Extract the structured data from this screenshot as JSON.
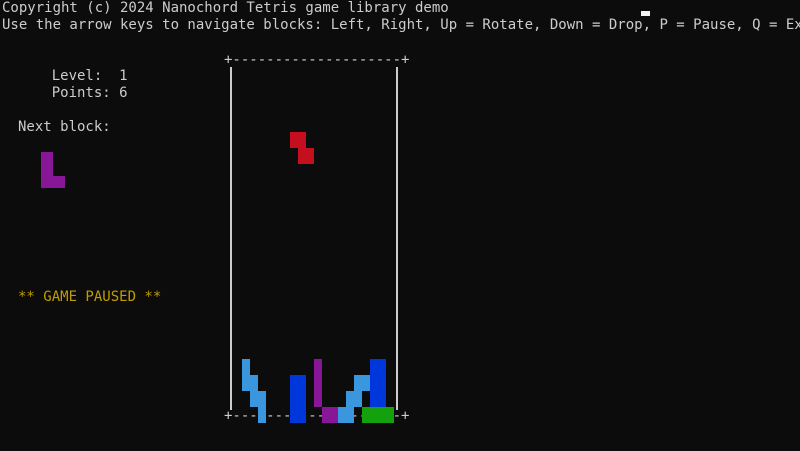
{
  "header": {
    "copyright": "Copyright (c) 2024 Nanochord Tetris game library demo",
    "instructions": "Use the arrow keys to navigate blocks: Left, Right, Up = Rotate, Down = Drop, P = Pause, Q = Exit"
  },
  "stats": {
    "level_label": "Level:",
    "level_value": "1",
    "points_label": "Points:",
    "points_value": "6",
    "next_block_label": "Next block:"
  },
  "status": {
    "paused_text": "** GAME PAUSED **"
  },
  "board": {
    "top_border": "+--------------------+",
    "bottom_border": "+--------------------+",
    "columns": 20,
    "rows": 43
  },
  "colors": {
    "background": "#0c0c0c",
    "text": "#cccccc",
    "paused": "#c19c00",
    "red": "#c50f1f",
    "purple": "#881798",
    "light_blue": "#3a96dd",
    "blue": "#0037da",
    "green": "#13a10e"
  },
  "next_block": {
    "shape": "L-tetromino",
    "color": "purple",
    "cells": [
      [
        0,
        0
      ],
      [
        0,
        1
      ],
      [
        0,
        2
      ],
      [
        1,
        2
      ]
    ]
  },
  "falling_block": {
    "shape": "Z-tetromino",
    "color": "red",
    "cells": [
      [
        7,
        19
      ],
      [
        8,
        19
      ],
      [
        7,
        20
      ],
      [
        8,
        20
      ],
      [
        8,
        21
      ],
      [
        9,
        21
      ],
      [
        8,
        22
      ],
      [
        9,
        22
      ]
    ]
  },
  "stack": [
    {
      "color": "light_blue",
      "cells": [
        [
          1,
          37
        ],
        [
          1,
          38
        ],
        [
          1,
          39
        ],
        [
          1,
          40
        ],
        [
          2,
          39
        ],
        [
          2,
          40
        ],
        [
          2,
          41
        ],
        [
          2,
          42
        ],
        [
          3,
          41
        ],
        [
          3,
          42
        ],
        [
          3,
          43
        ],
        [
          3,
          44
        ]
      ]
    },
    {
      "color": "blue",
      "cells": [
        [
          7,
          39
        ],
        [
          8,
          39
        ],
        [
          7,
          40
        ],
        [
          8,
          40
        ],
        [
          7,
          41
        ],
        [
          8,
          41
        ],
        [
          7,
          42
        ],
        [
          8,
          42
        ],
        [
          7,
          43
        ],
        [
          8,
          43
        ],
        [
          7,
          44
        ],
        [
          8,
          44
        ]
      ]
    },
    {
      "color": "purple",
      "cells": [
        [
          10,
          37
        ],
        [
          10,
          38
        ],
        [
          10,
          39
        ],
        [
          10,
          40
        ],
        [
          10,
          41
        ],
        [
          10,
          42
        ],
        [
          11,
          43
        ],
        [
          11,
          44
        ],
        [
          12,
          43
        ],
        [
          12,
          44
        ]
      ]
    },
    {
      "color": "light_blue",
      "cells": [
        [
          13,
          43
        ],
        [
          14,
          43
        ],
        [
          13,
          44
        ],
        [
          14,
          44
        ],
        [
          14,
          41
        ],
        [
          15,
          41
        ],
        [
          15,
          39
        ],
        [
          16,
          39
        ],
        [
          14,
          42
        ],
        [
          15,
          42
        ],
        [
          15,
          40
        ],
        [
          16,
          40
        ]
      ]
    },
    {
      "color": "blue",
      "cells": [
        [
          17,
          37
        ],
        [
          18,
          37
        ],
        [
          17,
          38
        ],
        [
          18,
          38
        ],
        [
          17,
          39
        ],
        [
          18,
          39
        ],
        [
          17,
          40
        ],
        [
          18,
          40
        ],
        [
          17,
          41
        ],
        [
          18,
          41
        ],
        [
          17,
          42
        ],
        [
          18,
          42
        ]
      ]
    },
    {
      "color": "green",
      "cells": [
        [
          16,
          43
        ],
        [
          17,
          43
        ],
        [
          18,
          43
        ],
        [
          19,
          43
        ],
        [
          16,
          44
        ],
        [
          17,
          44
        ],
        [
          18,
          44
        ],
        [
          19,
          44
        ]
      ]
    }
  ]
}
